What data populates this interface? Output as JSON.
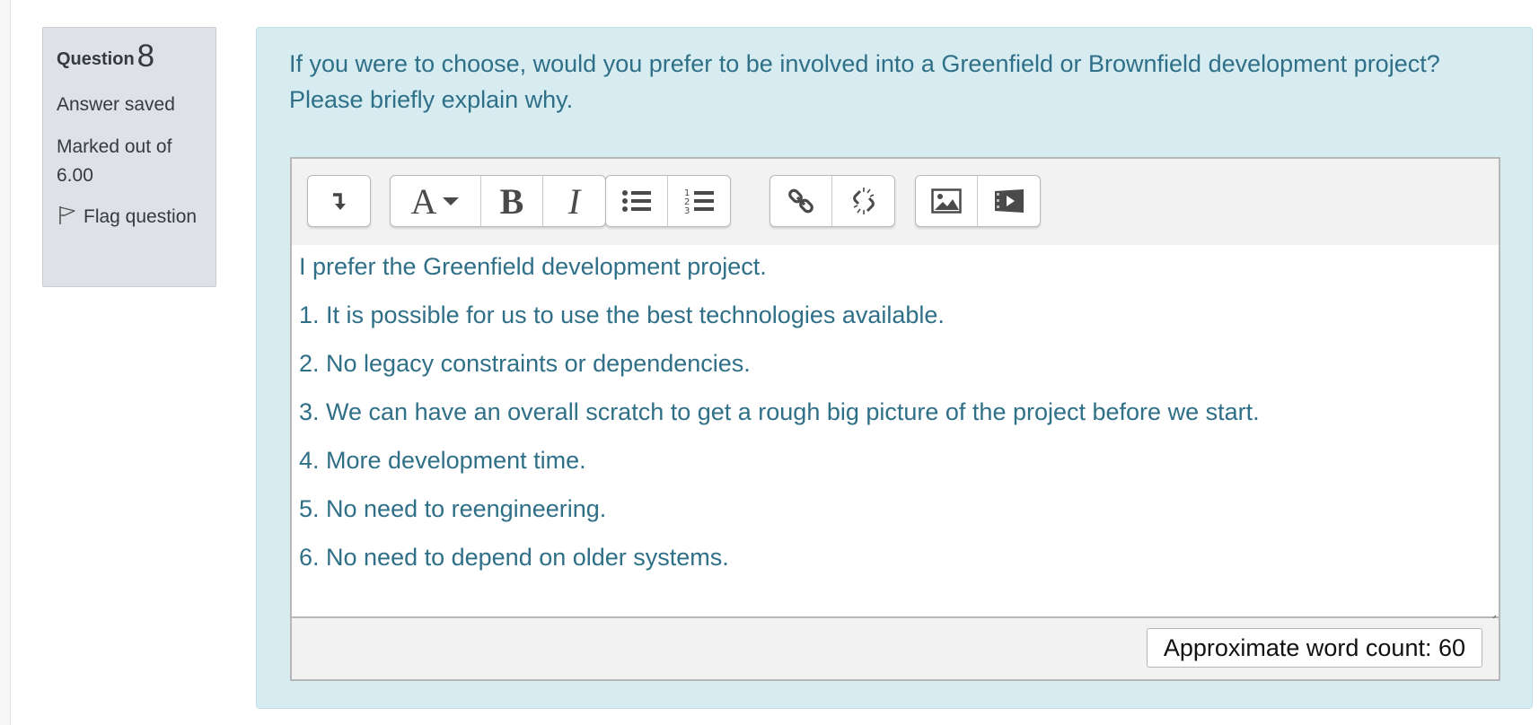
{
  "info": {
    "question_label": "Question",
    "question_number": "8",
    "state": "Answer saved",
    "grade": "Marked out of 6.00",
    "flag_label": "Flag question"
  },
  "question_text": "If you were to choose, would you prefer to be involved into a Greenfield or Brownfield development project? Please briefly explain why.",
  "toolbar": {
    "groups": [
      [
        "collapse-icon"
      ],
      [
        "font-style-dropdown-icon",
        "bold-icon",
        "italic-icon"
      ],
      [
        "unordered-list-icon",
        "ordered-list-icon"
      ],
      [
        "link-icon",
        "unlink-icon"
      ],
      [
        "image-icon",
        "media-icon"
      ]
    ],
    "font_glyph": "A",
    "bold_glyph": "B",
    "italic_glyph": "I"
  },
  "answer": {
    "paragraphs": [
      "I prefer the Greenfield development project.",
      "1. It is possible for us to use the best technologies available.",
      "2. No legacy constraints or dependencies.",
      "3. We can have an overall scratch to get a rough big picture of the project before we start.",
      "4. More development time.",
      "5. No need to reengineering.",
      "6. No need to depend on older systems."
    ]
  },
  "word_count": "Approximate word count: 60",
  "colors": {
    "info_bg": "#dee2e6",
    "formulation_bg": "#d6ecf1",
    "text_accent": "#2f6f87"
  }
}
